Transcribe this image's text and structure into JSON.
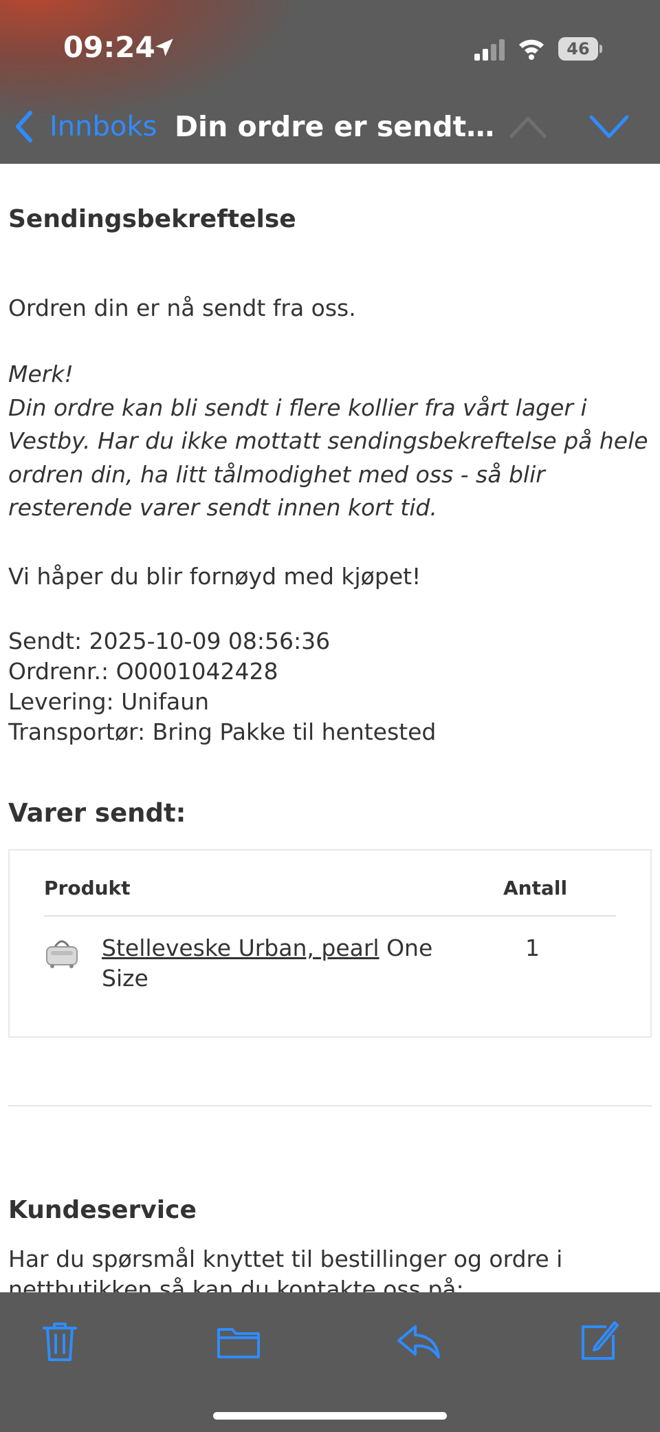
{
  "status_bar": {
    "time": "09:24",
    "battery": "46",
    "icons": [
      "location-arrow-icon",
      "cellular-signal-icon",
      "wifi-icon",
      "battery-icon"
    ]
  },
  "nav": {
    "back_label": "Innboks",
    "title": "Din ordre er sendt - B...",
    "icons": [
      "chevron-left-icon",
      "chevron-up-icon",
      "chevron-down-icon"
    ]
  },
  "colors": {
    "accent": "#2f8cff",
    "chrome": "#5c5c5c",
    "toolbar": "#5a5a5a",
    "text": "#333333"
  },
  "email": {
    "heading": "Sendingsbekreftelse",
    "intro": "Ordren din er nå sendt fra oss.",
    "note_title": "Merk!",
    "note_body": "Din ordre kan bli sendt i flere kollier fra vårt lager i Vestby. Har du ikke mottatt sendingsbekreftelse på hele ordren din, ha litt tålmodighet med oss - så blir resterende varer sendt innen kort tid.",
    "hope": "Vi håper du blir fornøyd med kjøpet!",
    "info_lines": [
      "Sendt: 2025-10-09 08:56:36",
      "Ordrenr.: O0001042428",
      "Levering: Unifaun",
      "Transportør: Bring Pakke til hentested"
    ],
    "items_heading": "Varer sendt:",
    "table": {
      "headers": [
        "Produkt",
        "Antall"
      ],
      "rows": [
        {
          "product_link": "Stelleveske Urban, pearl",
          "variant": " One Size",
          "quantity": "1"
        }
      ]
    },
    "service_heading": "Kundeservice",
    "service_text": "Har du spørsmål knyttet til bestillinger og ordre i nettbutikken så kan du kontakte oss på:"
  },
  "toolbar": {
    "icons": [
      "trash-icon",
      "folder-icon",
      "reply-icon",
      "compose-icon"
    ]
  }
}
